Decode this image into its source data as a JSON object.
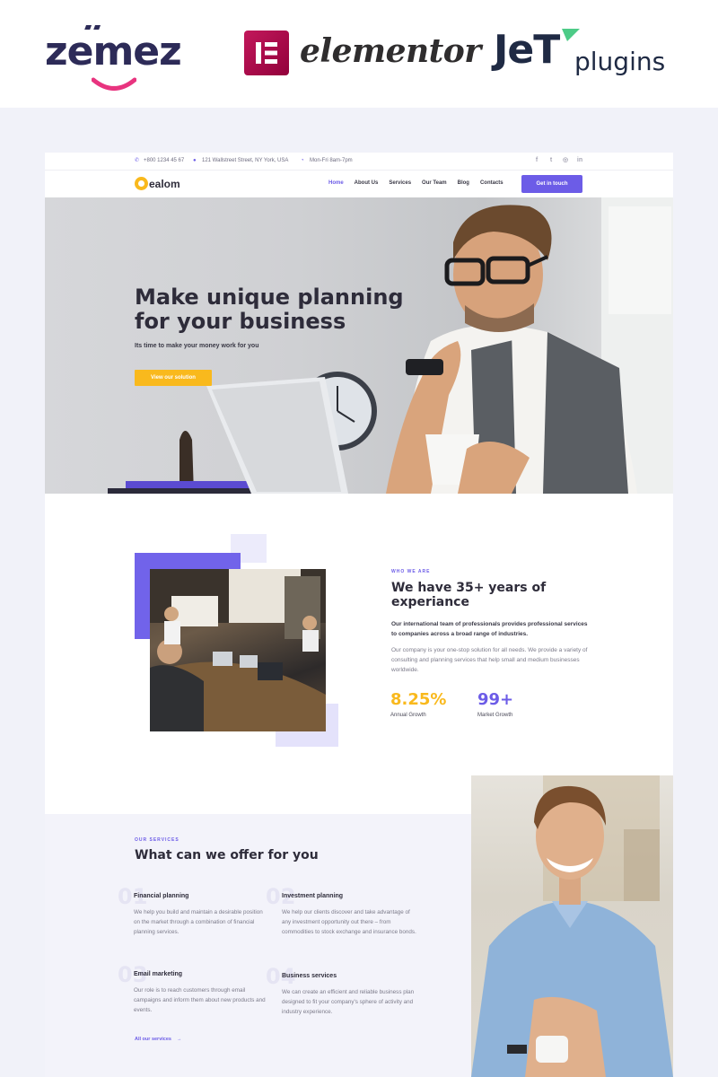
{
  "brands": {
    "zemez": "zemez",
    "elementor": "elementor",
    "jet_main": "JeT",
    "jet_plugins": "plugins"
  },
  "topbar": {
    "phone": "+800 1234 45 67",
    "address": "121 Wallstreet Street, NY York, USA",
    "hours": "Mon-Fri 8am-7pm",
    "social": [
      "facebook-icon",
      "twitter-icon",
      "instagram-icon",
      "linkedin-icon"
    ]
  },
  "nav": {
    "logo_text": "ealom",
    "links": [
      "Home",
      "About Us",
      "Services",
      "Our Team",
      "Blog",
      "Contacts"
    ],
    "active_link": "Home",
    "cta": "Get in touch"
  },
  "hero": {
    "title": "Make unique planning for your business",
    "subtitle": "Its time to make your money work for you",
    "button": "View our solution"
  },
  "about": {
    "label": "WHO WE ARE",
    "title": "We have 35+ years of experiance",
    "strong_text": "Our international team of professionals provides professional services to companies across a broad range of industries.",
    "body_text": "Our company is your one-stop solution for all needs. We provide a variety of consulting and planning services that help small and medium businesses worldwide.",
    "stats": [
      {
        "value": "8.25%",
        "label": "Annual Growth",
        "color": "#f9b91d"
      },
      {
        "value": "99+",
        "label": "Market Growth",
        "color": "#6c5ce7"
      }
    ]
  },
  "services": {
    "label": "OUR SERVICES",
    "title": "What can we offer for you",
    "items": [
      {
        "num": "01",
        "title": "Financial planning",
        "desc": "We help you build and maintain a desirable position on the market through a combination of financial planning services."
      },
      {
        "num": "02",
        "title": "Investment planning",
        "desc": "We help our clients discover and take advantage of any investment opportunity out there – from commodities to stock exchange and insurance bonds."
      },
      {
        "num": "03",
        "title": "Email marketing",
        "desc": "Our role is to reach customers through email campaigns and inform them about new products and events."
      },
      {
        "num": "04",
        "title": "Business services",
        "desc": "We can create an efficient and reliable business plan designed to fit your company's sphere of activity and industry experience."
      }
    ],
    "all_link": "All our services",
    "all_arrow": "→"
  },
  "colors": {
    "accent": "#6c5ce7",
    "yellow": "#f9b91d",
    "dark": "#2e2c3a"
  }
}
